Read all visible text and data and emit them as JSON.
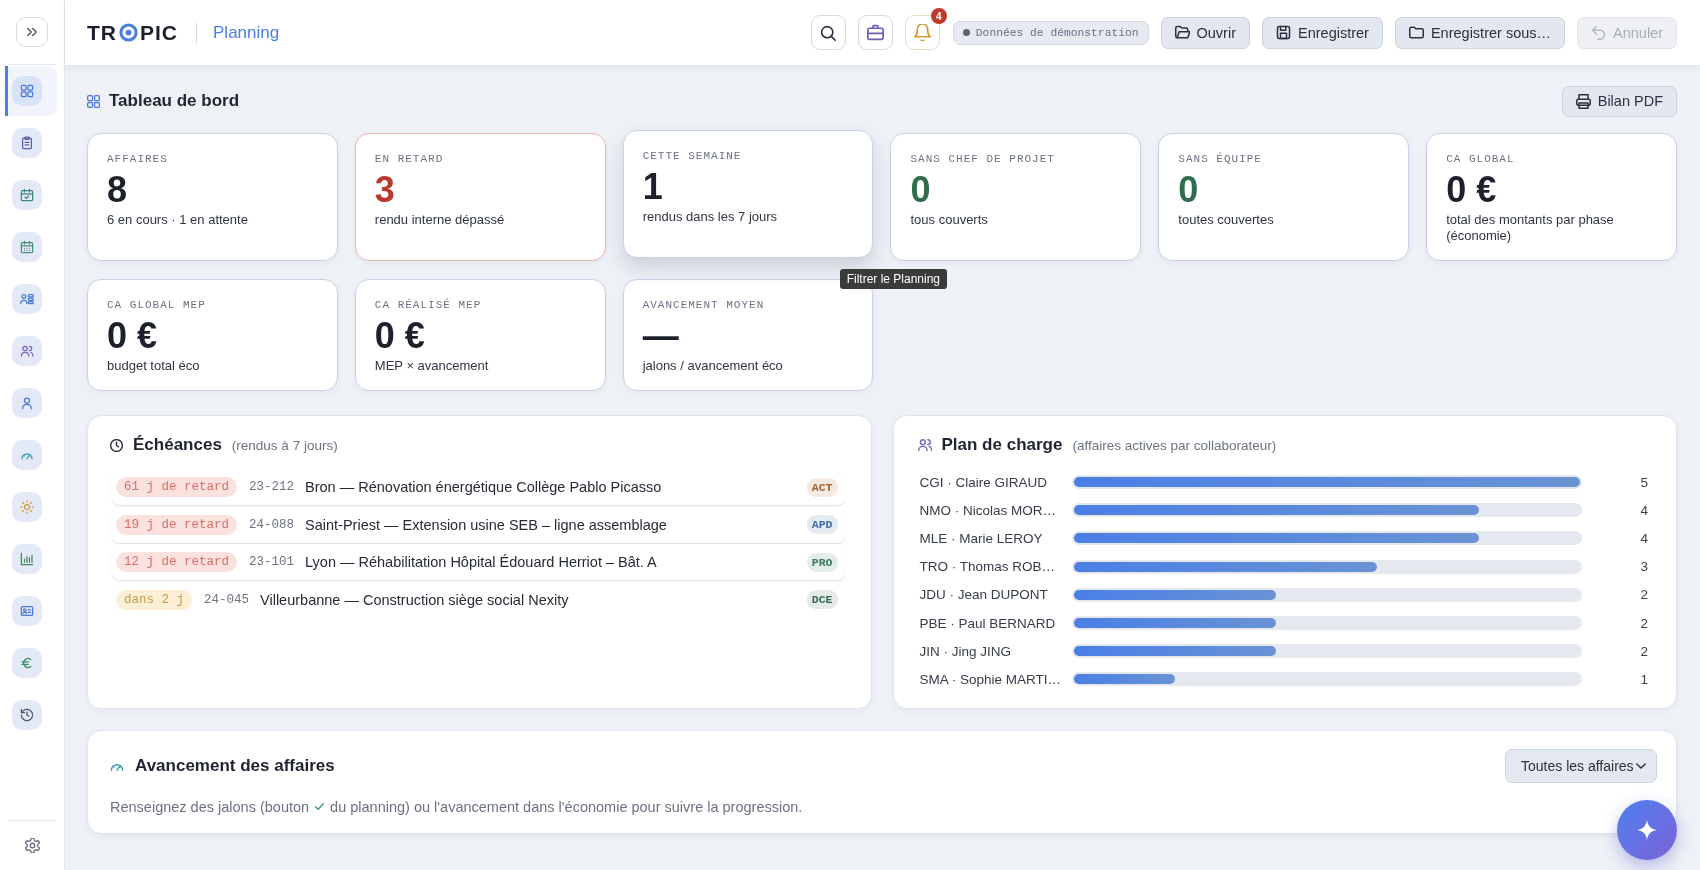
{
  "sidebar": {
    "items": [
      {
        "selected": true
      },
      {
        "selected": false
      },
      {
        "selected": false
      },
      {
        "selected": false
      },
      {
        "selected": false
      },
      {
        "selected": false
      },
      {
        "selected": false
      },
      {
        "selected": false
      },
      {
        "selected": false
      },
      {
        "selected": false
      },
      {
        "selected": false
      },
      {
        "selected": false
      },
      {
        "selected": false
      }
    ]
  },
  "header": {
    "logo": [
      "TR",
      "PIC"
    ],
    "section": "Planning",
    "notifications": {
      "count": "4"
    },
    "demo_badge": "Données de démonstration",
    "buttons": [
      {
        "label": "Ouvrir",
        "disabled": false
      },
      {
        "label": "Enregistrer",
        "disabled": false
      },
      {
        "label": "Enregistrer sous…",
        "disabled": false
      },
      {
        "label": "Annuler",
        "disabled": true
      }
    ]
  },
  "dashboard": {
    "title": "Tableau de bord",
    "export_button": "Bilan PDF",
    "cards": [
      {
        "label": "AFFAIRES",
        "value": "8",
        "caption": "6 en cours · 1 en attente",
        "kind": "neutral",
        "hovered": false
      },
      {
        "label": "EN RETARD",
        "value": "3",
        "caption": "rendu interne dépassé",
        "kind": "alert",
        "hovered": false
      },
      {
        "label": "CETTE SEMAINE",
        "value": "1",
        "caption": "rendus dans les 7 jours",
        "kind": "neutral",
        "hovered": true,
        "tooltip": "Filtrer le Planning"
      },
      {
        "label": "SANS CHEF DE PROJET",
        "value": "0",
        "caption": "tous couverts",
        "kind": "ok",
        "hovered": false
      },
      {
        "label": "SANS ÉQUIPE",
        "value": "0",
        "caption": "toutes couvertes",
        "kind": "ok",
        "hovered": false
      },
      {
        "label": "CA GLOBAL",
        "value": "0 €",
        "caption": "total des montants par phase (économie)",
        "kind": "neutral",
        "hovered": false
      },
      {
        "label": "CA GLOBAL MEP",
        "value": "0 €",
        "caption": "budget total éco",
        "kind": "neutral",
        "hovered": false
      },
      {
        "label": "CA RÉALISÉ MEP",
        "value": "0 €",
        "caption": "MEP × avancement",
        "kind": "neutral",
        "hovered": false
      },
      {
        "label": "AVANCEMENT MOYEN",
        "value": "—",
        "caption": "jalons / avancement éco",
        "kind": "neutral",
        "hovered": false
      }
    ]
  },
  "deadlines": {
    "title": "Échéances",
    "subtitle": "(rendus à 7 jours)",
    "rows": [
      {
        "delay": "61 j de retard",
        "kind": "late",
        "code": "23-212",
        "title": "Bron — Rénovation énergétique Collège Pablo Picasso",
        "phase": "ACT",
        "color": "#a3612c"
      },
      {
        "delay": "19 j de retard",
        "kind": "late",
        "code": "24-088",
        "title": "Saint-Priest — Extension usine SEB – ligne assemblage",
        "phase": "APD",
        "color": "#3d6ca8"
      },
      {
        "delay": "12 j de retard",
        "kind": "late",
        "code": "23-101",
        "title": "Lyon — Réhabilitation Hôpital Édouard Herriot – Bât. A",
        "phase": "PRO",
        "color": "#3b7a5b"
      },
      {
        "delay": "dans 2 j",
        "kind": "soon",
        "code": "24-045",
        "title": "Villeurbanne — Construction siège social Nexity",
        "phase": "DCE",
        "color": "#3a6b50"
      }
    ]
  },
  "workload": {
    "title": "Plan de charge",
    "subtitle": "(affaires actives par collaborateur)",
    "rows": [
      {
        "name": "CGI · Claire GIRAUD",
        "level": 1,
        "count": "5"
      },
      {
        "name": "NMO · Nicolas MOR…",
        "level": 0.8,
        "count": "4"
      },
      {
        "name": "MLE · Marie LEROY",
        "level": 0.8,
        "count": "4"
      },
      {
        "name": "TRO · Thomas ROB…",
        "level": 0.6,
        "count": "3"
      },
      {
        "name": "JDU · Jean DUPONT",
        "level": 0.4,
        "count": "2"
      },
      {
        "name": "PBE · Paul BERNARD",
        "level": 0.4,
        "count": "2"
      },
      {
        "name": "JIN · Jing JING",
        "level": 0.4,
        "count": "2"
      },
      {
        "name": "SMA · Sophie MARTI…",
        "level": 0.2,
        "count": "1"
      }
    ]
  },
  "progress": {
    "title": "Avancement des affaires",
    "filter": "Toutes les affaires",
    "hint_before": "Renseignez des jalons (bouton",
    "hint_after": "du planning) ou l'avancement dans l'économie pour suivre la progression."
  }
}
